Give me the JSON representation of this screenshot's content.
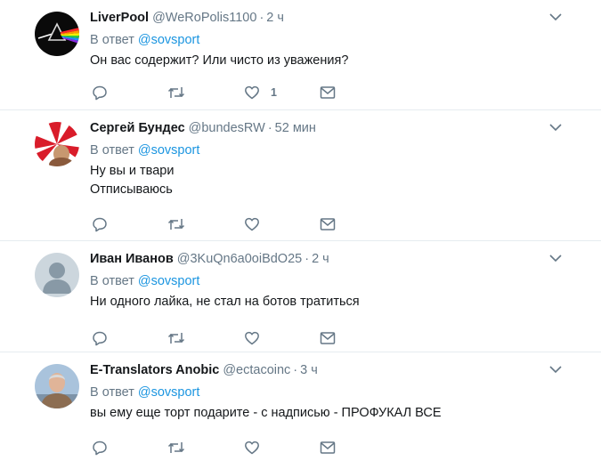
{
  "tweets": [
    {
      "name": "LiverPool",
      "handle": "@WeRoPolis1100",
      "dot": "·",
      "time": "2 ч",
      "reply_prefix": "В ответ",
      "reply_to": "@sovsport",
      "lines": [
        "Он вас содержит? Или чисто из уважения?"
      ],
      "like_count": "1",
      "avatar_icon": "prism-rainbow-avatar"
    },
    {
      "name": "Сергей Бундес",
      "handle": "@bundesRW",
      "dot": "·",
      "time": "52 мин",
      "reply_prefix": "В ответ",
      "reply_to": "@sovsport",
      "lines": [
        "Ну вы и твари",
        "Отписываюсь"
      ],
      "like_count": "",
      "avatar_icon": "red-white-flag-avatar"
    },
    {
      "name": "Иван Иванов",
      "handle": "@3KuQn6a0oiBdO25",
      "dot": "·",
      "time": "2 ч",
      "reply_prefix": "В ответ",
      "reply_to": "@sovsport",
      "lines": [
        "Ни одного лайка, не стал на ботов тратиться"
      ],
      "like_count": "",
      "avatar_icon": "default-person-avatar"
    },
    {
      "name": "E-Translators Anobic",
      "handle": "@ectacoinc",
      "dot": "·",
      "time": "3 ч",
      "reply_prefix": "В ответ",
      "reply_to": "@sovsport",
      "lines": [
        "вы ему еще торт подарите - с надписью - ПРОФУКАЛ ВСЕ"
      ],
      "like_count": "",
      "avatar_icon": "photo-man-avatar"
    }
  ],
  "colors": {
    "accent": "#1b95e0",
    "muted": "#657786",
    "text": "#14171a",
    "divider": "#e6ecf0"
  },
  "icons": [
    "reply-icon",
    "retweet-icon",
    "like-icon",
    "message-icon",
    "chevron-down-icon"
  ]
}
